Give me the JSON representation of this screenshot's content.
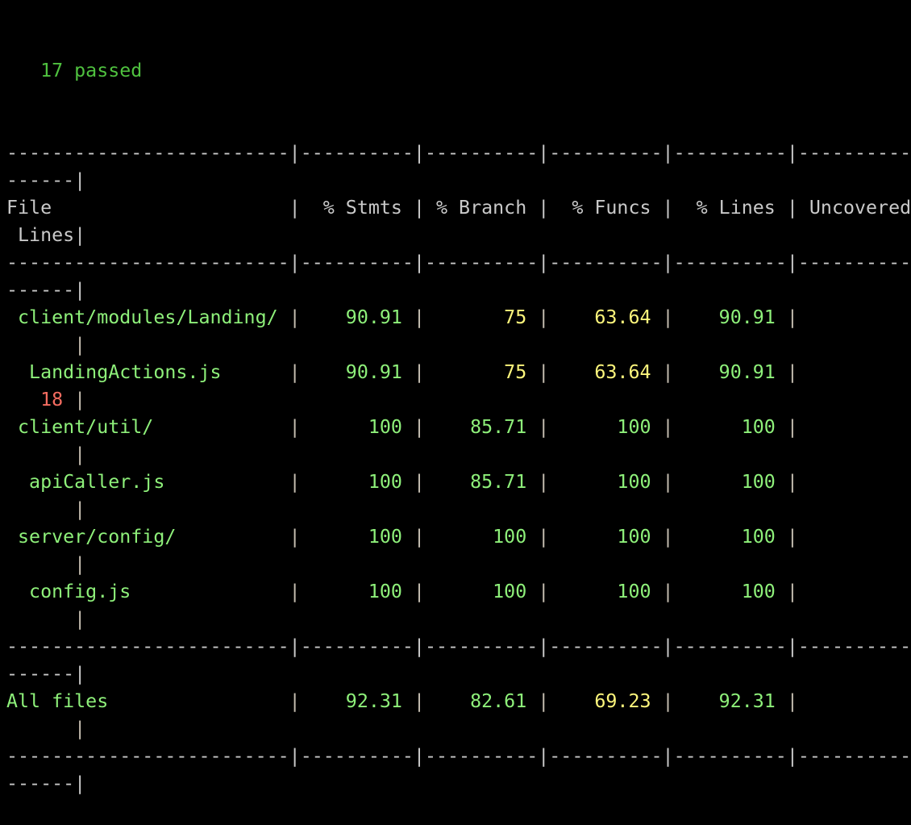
{
  "window": {
    "type": "terminal",
    "background": "#000000"
  },
  "summary": {
    "text": "17 passed",
    "color": "#4fc13f"
  },
  "colors": {
    "high": "#8ef07a",
    "medium": "#fdf67c",
    "low": "#f56c60",
    "text": "#c9c9c9"
  },
  "table": {
    "headers": [
      "File",
      "% Stmts",
      "% Branch",
      "% Funcs",
      "% Lines",
      "Uncovered Lines"
    ],
    "rows": [
      {
        "file": "client/modules/Landing/",
        "indent": 1,
        "stmts": "90.91",
        "branch": "75",
        "funcs": "63.64",
        "lines": "90.91",
        "uncovered": "",
        "levels": [
          "high",
          "medium",
          "medium",
          "high"
        ]
      },
      {
        "file": "LandingActions.js",
        "indent": 2,
        "stmts": "90.91",
        "branch": "75",
        "funcs": "63.64",
        "lines": "90.91",
        "uncovered": "18",
        "levels": [
          "high",
          "medium",
          "medium",
          "high"
        ]
      },
      {
        "file": "client/util/",
        "indent": 1,
        "stmts": "100",
        "branch": "85.71",
        "funcs": "100",
        "lines": "100",
        "uncovered": "",
        "levels": [
          "high",
          "high",
          "high",
          "high"
        ]
      },
      {
        "file": "apiCaller.js",
        "indent": 2,
        "stmts": "100",
        "branch": "85.71",
        "funcs": "100",
        "lines": "100",
        "uncovered": "",
        "levels": [
          "high",
          "high",
          "high",
          "high"
        ]
      },
      {
        "file": "server/config/",
        "indent": 1,
        "stmts": "100",
        "branch": "100",
        "funcs": "100",
        "lines": "100",
        "uncovered": "",
        "levels": [
          "high",
          "high",
          "high",
          "high"
        ]
      },
      {
        "file": "config.js",
        "indent": 2,
        "stmts": "100",
        "branch": "100",
        "funcs": "100",
        "lines": "100",
        "uncovered": "",
        "levels": [
          "high",
          "high",
          "high",
          "high"
        ]
      }
    ],
    "total": {
      "file": "All files",
      "stmts": "92.31",
      "branch": "82.61",
      "funcs": "69.23",
      "lines": "92.31",
      "levels": [
        "high",
        "high",
        "medium",
        "high"
      ]
    }
  }
}
